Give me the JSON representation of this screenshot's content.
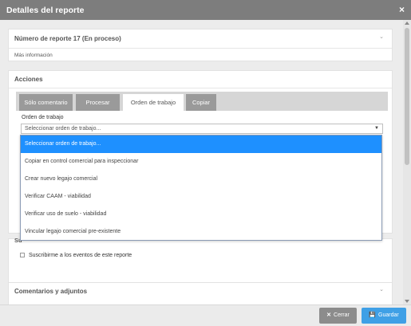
{
  "window": {
    "title": "Detalles del reporte",
    "close_glyph": "×",
    "close_icon": "close-icon"
  },
  "report_panel": {
    "title": "Número de reporte 17 (En proceso)",
    "chevron": "⌄",
    "more_info": "Más información"
  },
  "actions_panel": {
    "title": "Acciones",
    "tabs": [
      {
        "label": "Sólo comentario",
        "active": false
      },
      {
        "label": "Procesar",
        "active": false
      },
      {
        "label": "Orden de trabajo",
        "active": true
      },
      {
        "label": "Copiar",
        "active": false
      }
    ],
    "field_label": "Orden de trabajo",
    "select_value": "Seleccionar orden de trabajo...",
    "caret": "▼"
  },
  "dropdown": {
    "options": [
      {
        "label": "Seleccionar orden de trabajo...",
        "selected": true
      },
      {
        "label": "Copiar en control comercial para inspeccionar",
        "selected": false
      },
      {
        "label": "Crear nuevo legajo comercial",
        "selected": false
      },
      {
        "label": "Verificar CAAM - viabilidad",
        "selected": false
      },
      {
        "label": "Verificar uso de suelo - viabilidad",
        "selected": false
      },
      {
        "label": "Vincular legajo comercial pre-existente",
        "selected": false
      }
    ],
    "selected_color": "#1e90ff"
  },
  "subscription_panel": {
    "label_fragment": "Su",
    "checkbox_label": "Suscribirme a los eventos de este reporte",
    "checked": false
  },
  "comments_panel": {
    "title": "Comentarios y adjuntos",
    "chevron": "⌄"
  },
  "footer": {
    "close_label": "Cerrar",
    "close_glyph": "✕",
    "save_label": "Guardar",
    "save_glyph": "💾"
  },
  "colors": {
    "titlebar": "#7d7d7d",
    "tab_inactive": "#9a9a9a",
    "save_button": "#3fa0e6",
    "close_button": "#8c8c8c"
  }
}
